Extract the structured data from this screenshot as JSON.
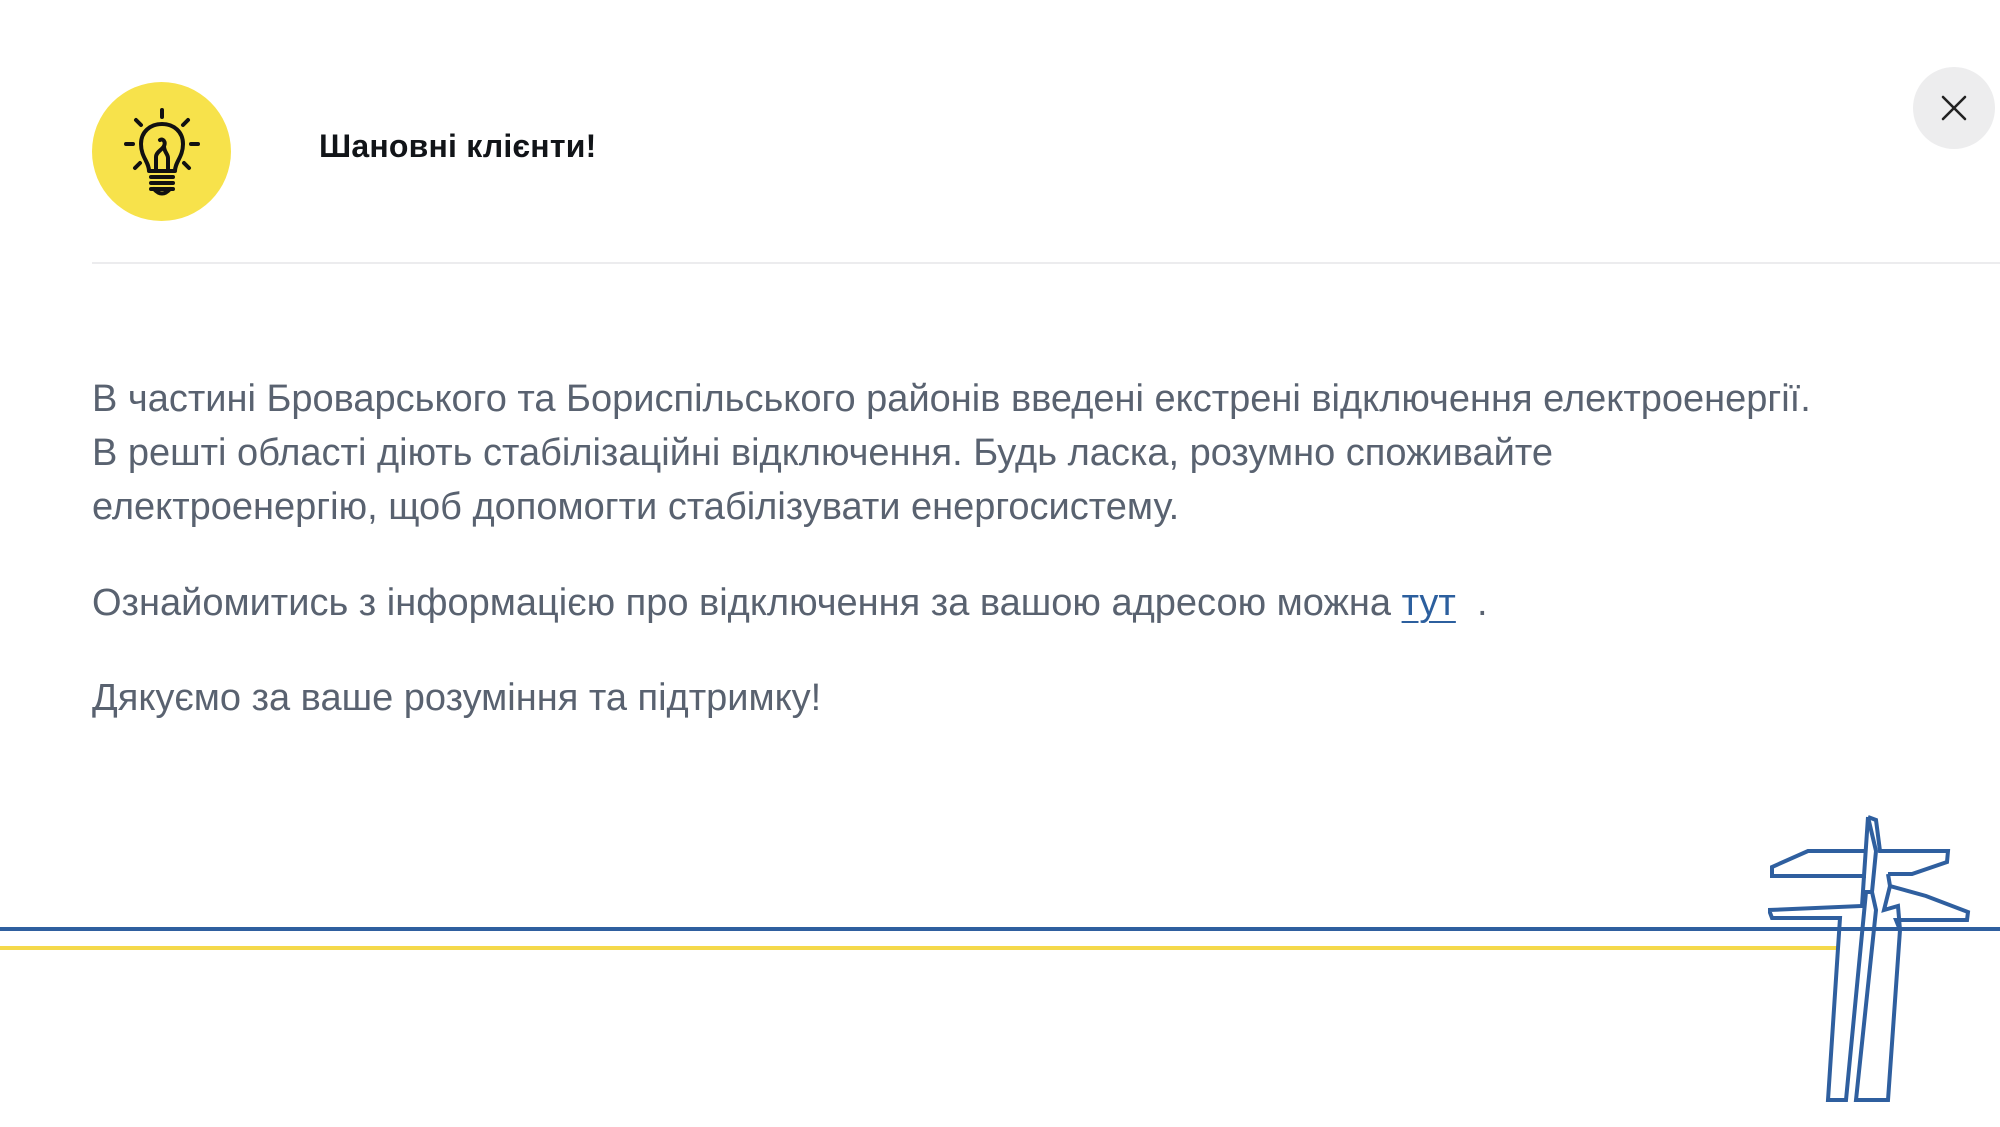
{
  "header": {
    "icon": "lightbulb-icon",
    "title": "Шановні клієнти!"
  },
  "close_button": {
    "icon": "close-icon"
  },
  "message": {
    "line1": "В частині Броварського та Бориспільського районів введені екстрені відключення електроенергії.",
    "line2": "В решті області діють стабілізаційні відключення. Будь ласка, розумно споживайте",
    "line3": "електроенергію, щоб допомогти стабілізувати енергосистему.",
    "info_prefix": "Ознайомитись з інформацією про відключення за вашою адресою можна ",
    "info_link": "тут",
    "info_suffix": "  .",
    "thanks": "Дякуємо за ваше розуміння та підтримку!"
  },
  "decoration": {
    "power_tower": "power-tower-icon"
  },
  "colors": {
    "accent_yellow": "#f7e24b",
    "accent_blue": "#2f5f9f",
    "link": "#2c5f9e",
    "body_text": "#596270",
    "title_text": "#111418"
  }
}
